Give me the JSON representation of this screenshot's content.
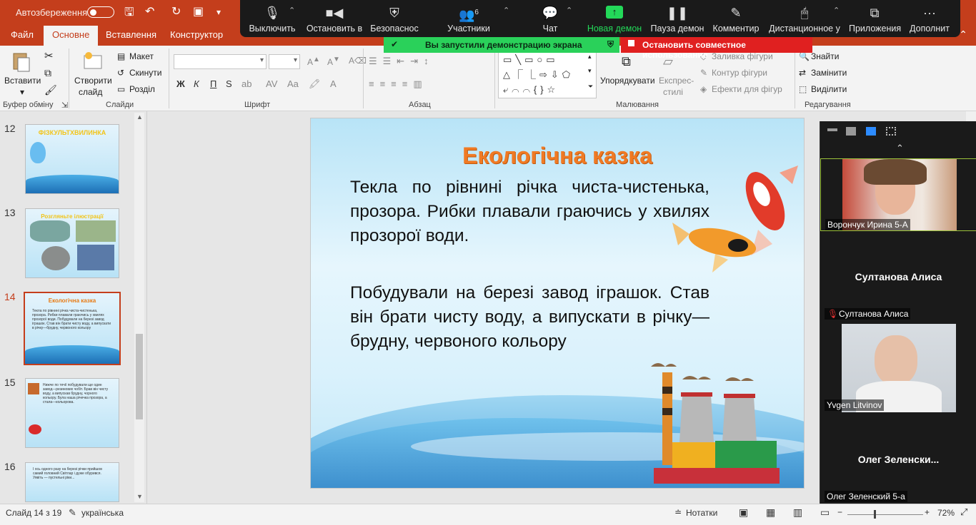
{
  "titlebar": {
    "autosave_label": "Автозбереження",
    "right_text": ""
  },
  "tabs": [
    {
      "label": "Файл"
    },
    {
      "label": "Основне"
    },
    {
      "label": "Вставлення"
    },
    {
      "label": "Конструктор"
    }
  ],
  "ribbon": {
    "clipboard": {
      "paste": "Вставити",
      "group": "Буфер обміну"
    },
    "slides": {
      "new_slide": "Створити",
      "new_slide2": "слайд",
      "layout": "Макет",
      "reset": "Скинути",
      "section": "Розділ",
      "group": "Слайди"
    },
    "font": {
      "group": "Шрифт",
      "bold": "Ж",
      "italic": "К",
      "underline": "П",
      "strike": "S"
    },
    "paragraph": {
      "group": "Абзац"
    },
    "drawing": {
      "arrange": "Упорядкувати",
      "quick_styles": "Експрес-",
      "quick_styles2": "стилі",
      "fill": "Заливка фігури",
      "outline": "Контур фігури",
      "effects": "Ефекти для фігур",
      "group": "Малювання"
    },
    "editing": {
      "find": "Знайти",
      "replace": "Замінити",
      "select": "Виділити",
      "group": "Редагування"
    }
  },
  "zoom_toolbar": {
    "items": [
      {
        "label": "Выключить"
      },
      {
        "label": "Остановить в"
      },
      {
        "label": "Безопаснос"
      },
      {
        "label": "Участники",
        "count": "6"
      },
      {
        "label": "Чат"
      },
      {
        "label": "Новая демон"
      },
      {
        "label": "Пауза демон"
      },
      {
        "label": "Комментир"
      },
      {
        "label": "Дистанционное у"
      },
      {
        "label": "Приложения"
      },
      {
        "label": "Дополнит"
      }
    ],
    "share_notice": "Вы запустили демонстрацию экрана",
    "stop_share": "Остановить совместное использование"
  },
  "thumbnails": [
    {
      "num": "12",
      "title": "ФІЗКУЛЬТХВИЛИНКА"
    },
    {
      "num": "13",
      "title": "Розгляньте ілюстрації"
    },
    {
      "num": "14",
      "title": "Екологічна казка",
      "lines": "Текла по рівнині річка чиста-чистенька, прозора. Рибки плавали граючись у хвилях прозорої води. Побудували на березі завод іграшок. Став він брати чисту воду, а випускати в річку—брудну, червоного кольору"
    },
    {
      "num": "15",
      "title": "",
      "lines": "Нижче по течії побудували ще один завод—резинових чобіт. Брав він чисту воду, а випускав брудну, чорного кольору. Була наша річечка прозора, а стала—кольорова."
    },
    {
      "num": "16",
      "title": "",
      "lines": "І ось одного разу на березі річки прийшов самий головний Світлар і дуже обурився. Уявіть — пустельні ріки..."
    }
  ],
  "slide": {
    "title": "Екологічна казка",
    "paragraph1": "Текла по рівнині річка чиста-чистенька, прозора. Рибки плавали граючись у хвилях прозорої води.",
    "paragraph2": "Побудували на березі завод іграшок. Став він брати чисту воду, а випускати в річку—брудну, червоного кольору"
  },
  "participants": [
    {
      "name": "Ворончук Ирина 5-А",
      "video": true
    },
    {
      "name": "Султанова Алиса",
      "center": "Султанова Алиса",
      "muted": true
    },
    {
      "name": "Yvgen Litvinov",
      "video": true
    },
    {
      "name": "Олег Зеленский 5-а",
      "center": "Олег  Зеленски..."
    }
  ],
  "status": {
    "slide_info": "Слайд 14 з 19",
    "language": "українська",
    "notes": "Нотатки",
    "zoom": "72%"
  },
  "colors": {
    "accent": "#c43e1c",
    "zoom_green": "#23d959",
    "zoom_red": "#e02020",
    "title_orange": "#f07a24"
  }
}
